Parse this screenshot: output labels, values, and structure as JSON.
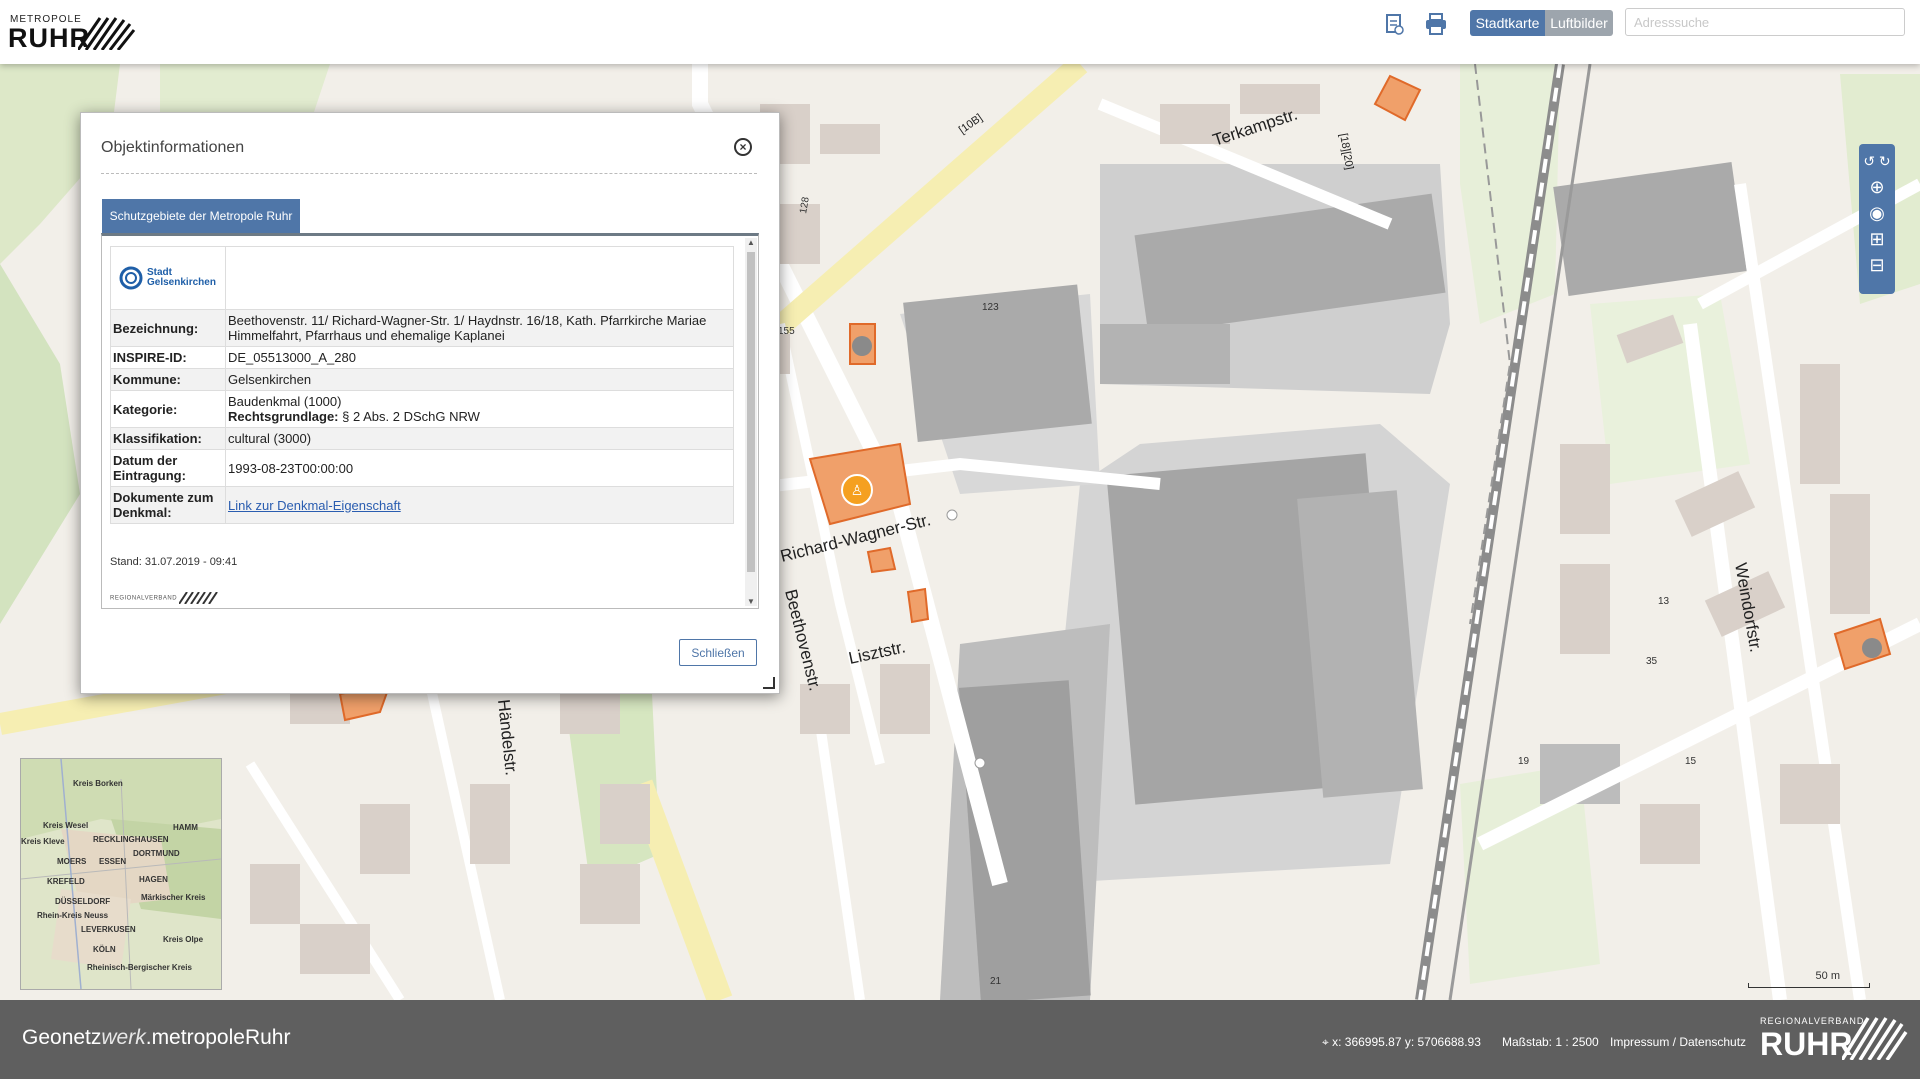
{
  "header": {
    "logo_small": "METROPOLE",
    "logo_big": "RUHR",
    "icons": [
      "document-icon",
      "print-icon"
    ],
    "layer_tabs": [
      {
        "label": "Stadtkarte",
        "active": true
      },
      {
        "label": "Luftbilder",
        "active": false
      }
    ],
    "search_placeholder": "Adresssuche",
    "accent": "#4f76a8"
  },
  "map": {
    "streets": [
      "Terkampstr.",
      "Richard-Wagner-Str.",
      "Beethovenstr.",
      "Lisztstr.",
      "Händelstr.",
      "Weindorfstr.",
      "[10B]",
      "[18][20]"
    ],
    "house_numbers": [
      "123",
      "128",
      "155",
      "21",
      "19",
      "35",
      "13",
      "15"
    ],
    "tools": [
      "undo-icon",
      "redo-icon",
      "zoom-in-icon",
      "globe-icon",
      "zoom-extend-icon",
      "zoom-out-icon"
    ],
    "inset_labels": [
      "Kreis Borken",
      "Kreis Wesel",
      "RECKLINGHAUSEN",
      "HAMM",
      "Kreis Kleve",
      "DORTMUND",
      "MOERS",
      "ESSEN",
      "HAGEN",
      "KREFELD",
      "DÜSSELDORF",
      "Märkischer Kreis",
      "Rhein-Kreis Neuss",
      "LEVERKUSEN",
      "Kreis Olpe",
      "KÖLN",
      "Rheinisch-Bergischer Kreis"
    ],
    "scalebar_label": "50 m"
  },
  "dialog": {
    "title": "Objektinformationen",
    "tab_label": "Schutzgebiete der Metropole Ruhr",
    "logo_text_1": "Stadt",
    "logo_text_2": "Gelsenkirchen",
    "rows": [
      {
        "label": "Bezeichnung:",
        "value": "Beethovenstr. 11/ Richard-Wagner-Str. 1/ Haydnstr. 16/18, Kath. Pfarrkirche Mariae Himmelfahrt, Pfarrhaus und ehemalige Kaplanei"
      },
      {
        "label": "INSPIRE-ID:",
        "value": "DE_05513000_A_280"
      },
      {
        "label": "Kommune:",
        "value": "Gelsenkirchen"
      },
      {
        "label": "Kategorie:",
        "value": "Baudenkmal (1000)",
        "extra_label": "Rechtsgrundlage:",
        "extra_value": "§ 2 Abs. 2 DSchG NRW"
      },
      {
        "label": "Klassifikation:",
        "value": "cultural (3000)"
      },
      {
        "label": "Datum der Eintragung:",
        "value": "1993-08-23T00:00:00"
      },
      {
        "label": "Dokumente zum Denkmal:",
        "value": "Link zur Denkmal-Eigenschaft"
      }
    ],
    "stand": "Stand: 31.07.2019 - 09:41",
    "footer_logo": "REGIONALVERBAND",
    "close_button": "Schließen"
  },
  "footer": {
    "brand_prefix": "Geonetz",
    "brand_italic": "werk",
    "brand_suffix": ".metropoleRuhr",
    "coordinates": "x: 366995.87 y: 5706688.93",
    "scale": "Maßstab: 1 : 2500",
    "links": "Impressum / Datenschutz",
    "logo_small": "REGIONALVERBAND",
    "logo_big": "RUHR"
  }
}
